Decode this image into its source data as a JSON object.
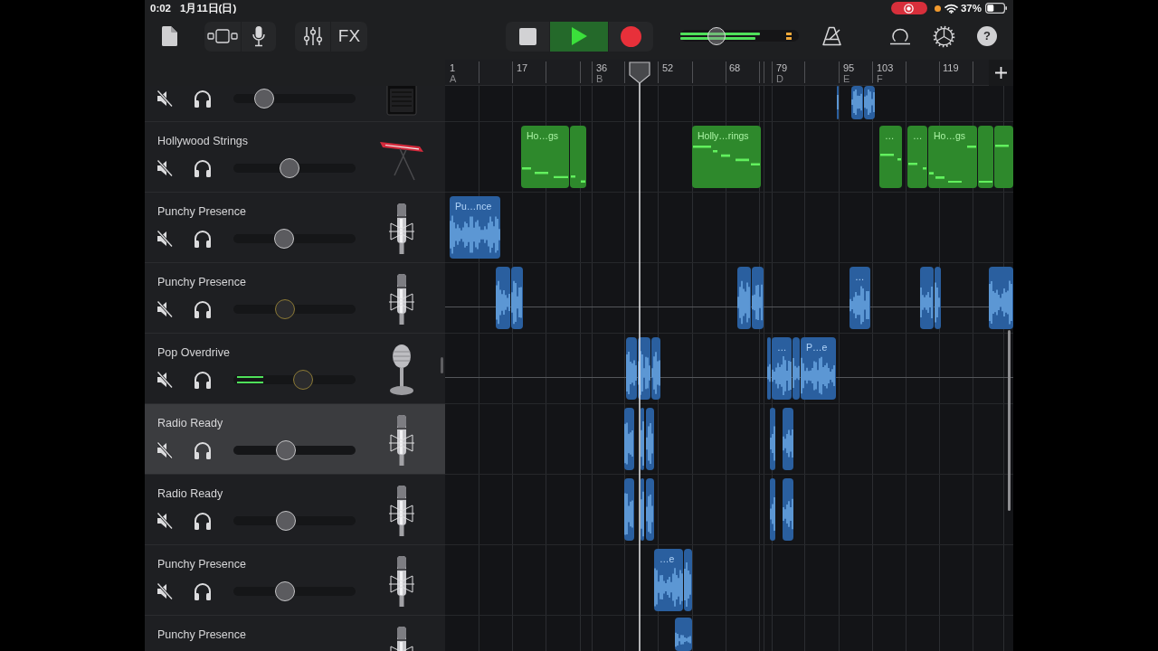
{
  "status_bar": {
    "time": "0:02",
    "date": "1月11日(日)",
    "battery": "37%"
  },
  "toolbar": {
    "fx_label": "FX",
    "help_label": "?",
    "playing": true,
    "master_volume": {
      "level": 0.27
    },
    "master_meters": [
      {
        "level": 0.67
      },
      {
        "level": 0.63
      }
    ]
  },
  "ruler": {
    "bars": [
      {
        "number": "1",
        "section": "A"
      },
      {
        "number": "17"
      },
      {
        "number": "36",
        "section": "B"
      },
      {
        "number": "52"
      },
      {
        "number": "68"
      },
      {
        "number": "79",
        "section": "D"
      },
      {
        "number": "95",
        "section": "E"
      },
      {
        "number": "103",
        "section": "F"
      },
      {
        "number": "119"
      }
    ]
  },
  "tracks": [
    {
      "kind": "amp",
      "selected": false,
      "volume": {
        "level": 0.2,
        "automated": false
      },
      "regions": [
        {
          "kind": "audio"
        },
        {
          "kind": "audio"
        },
        {
          "kind": "audio"
        }
      ]
    },
    {
      "name": "Hollywood Strings",
      "kind": "keyboard",
      "selected": false,
      "volume": {
        "level": 0.45,
        "automated": false
      },
      "regions": [
        {
          "kind": "midi",
          "label": "Ho…gs"
        },
        {
          "kind": "midi"
        },
        {
          "kind": "midi",
          "label": "Holly…rings"
        },
        {
          "kind": "midi",
          "label": "…"
        },
        {
          "kind": "midi",
          "label": "…"
        },
        {
          "kind": "midi",
          "label": "Ho…gs"
        },
        {
          "kind": "midi"
        },
        {
          "kind": "midi"
        }
      ]
    },
    {
      "name": "Punchy Presence",
      "kind": "condenser-mic",
      "selected": false,
      "volume": {
        "level": 0.4,
        "automated": false
      },
      "regions": [
        {
          "kind": "audio",
          "label": "Pu…nce"
        }
      ]
    },
    {
      "name": "Punchy Presence",
      "kind": "condenser-mic",
      "selected": false,
      "volume": {
        "level": 0.41,
        "automated": true
      },
      "regions": [
        {
          "kind": "audio"
        },
        {
          "kind": "audio"
        },
        {
          "kind": "audio"
        },
        {
          "kind": "audio"
        },
        {
          "kind": "audio",
          "label": "…"
        },
        {
          "kind": "audio"
        },
        {
          "kind": "audio"
        },
        {
          "kind": "audio"
        }
      ]
    },
    {
      "name": "Pop Overdrive",
      "kind": "vintage-mic",
      "selected": false,
      "volume": {
        "level": 0.58,
        "automated": true
      },
      "meter": {
        "level": 0.23
      },
      "regions": [
        {
          "kind": "audio"
        },
        {
          "kind": "audio"
        },
        {
          "kind": "audio"
        },
        {
          "kind": "audio"
        },
        {
          "kind": "audio",
          "label": "…"
        },
        {
          "kind": "audio"
        },
        {
          "kind": "audio",
          "label": "P…e"
        }
      ]
    },
    {
      "name": "Radio Ready",
      "kind": "condenser-mic",
      "selected": true,
      "volume": {
        "level": 0.42,
        "automated": false
      },
      "regions": [
        {
          "kind": "audio"
        },
        {
          "kind": "audio"
        },
        {
          "kind": "audio"
        },
        {
          "kind": "audio"
        },
        {
          "kind": "audio"
        }
      ]
    },
    {
      "name": "Radio Ready",
      "kind": "condenser-mic",
      "selected": false,
      "volume": {
        "level": 0.42,
        "automated": false
      },
      "regions": [
        {
          "kind": "audio"
        },
        {
          "kind": "audio"
        },
        {
          "kind": "audio"
        },
        {
          "kind": "audio"
        },
        {
          "kind": "audio"
        }
      ]
    },
    {
      "name": "Punchy Presence",
      "kind": "condenser-mic",
      "selected": false,
      "volume": {
        "level": 0.41,
        "automated": false
      },
      "regions": [
        {
          "kind": "audio",
          "label": "…e"
        },
        {
          "kind": "audio"
        }
      ]
    },
    {
      "name": "Punchy Presence",
      "kind": "condenser-mic",
      "selected": false,
      "regions": [
        {
          "kind": "audio"
        }
      ]
    }
  ]
}
